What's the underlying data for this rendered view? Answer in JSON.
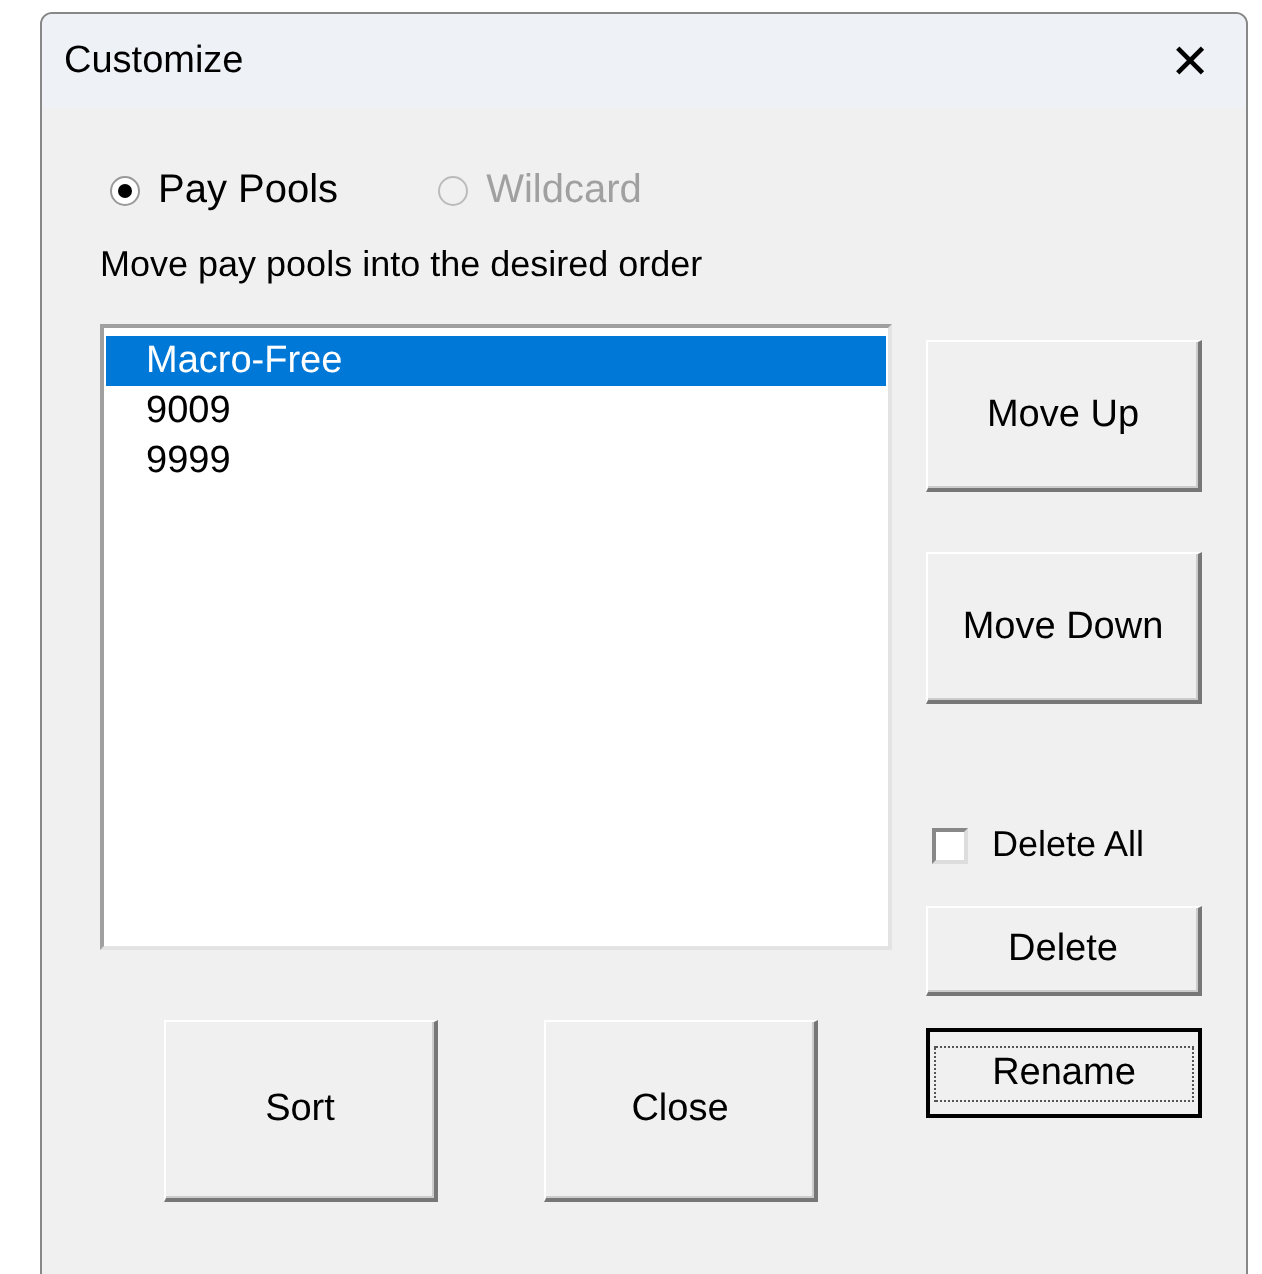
{
  "window": {
    "title": "Customize",
    "close": "✕"
  },
  "radios": [
    {
      "label": "Pay Pools",
      "selected": true,
      "disabled": false
    },
    {
      "label": "Wildcard",
      "selected": false,
      "disabled": true
    }
  ],
  "instruction": "Move pay pools into the desired order",
  "list": [
    {
      "label": "Macro-Free",
      "selected": true
    },
    {
      "label": "9009",
      "selected": false
    },
    {
      "label": "9999",
      "selected": false
    }
  ],
  "side_buttons": [
    {
      "label": "Move Up",
      "default": false
    },
    {
      "label": "Move Down",
      "default": false
    }
  ],
  "delete_all": {
    "label": "Delete All",
    "checked": false
  },
  "action_buttons": [
    {
      "label": "Delete",
      "default": false
    },
    {
      "label": "Rename",
      "default": true
    }
  ],
  "bottom_buttons": [
    {
      "label": "Sort",
      "default": false
    },
    {
      "label": "Close",
      "default": false
    }
  ]
}
